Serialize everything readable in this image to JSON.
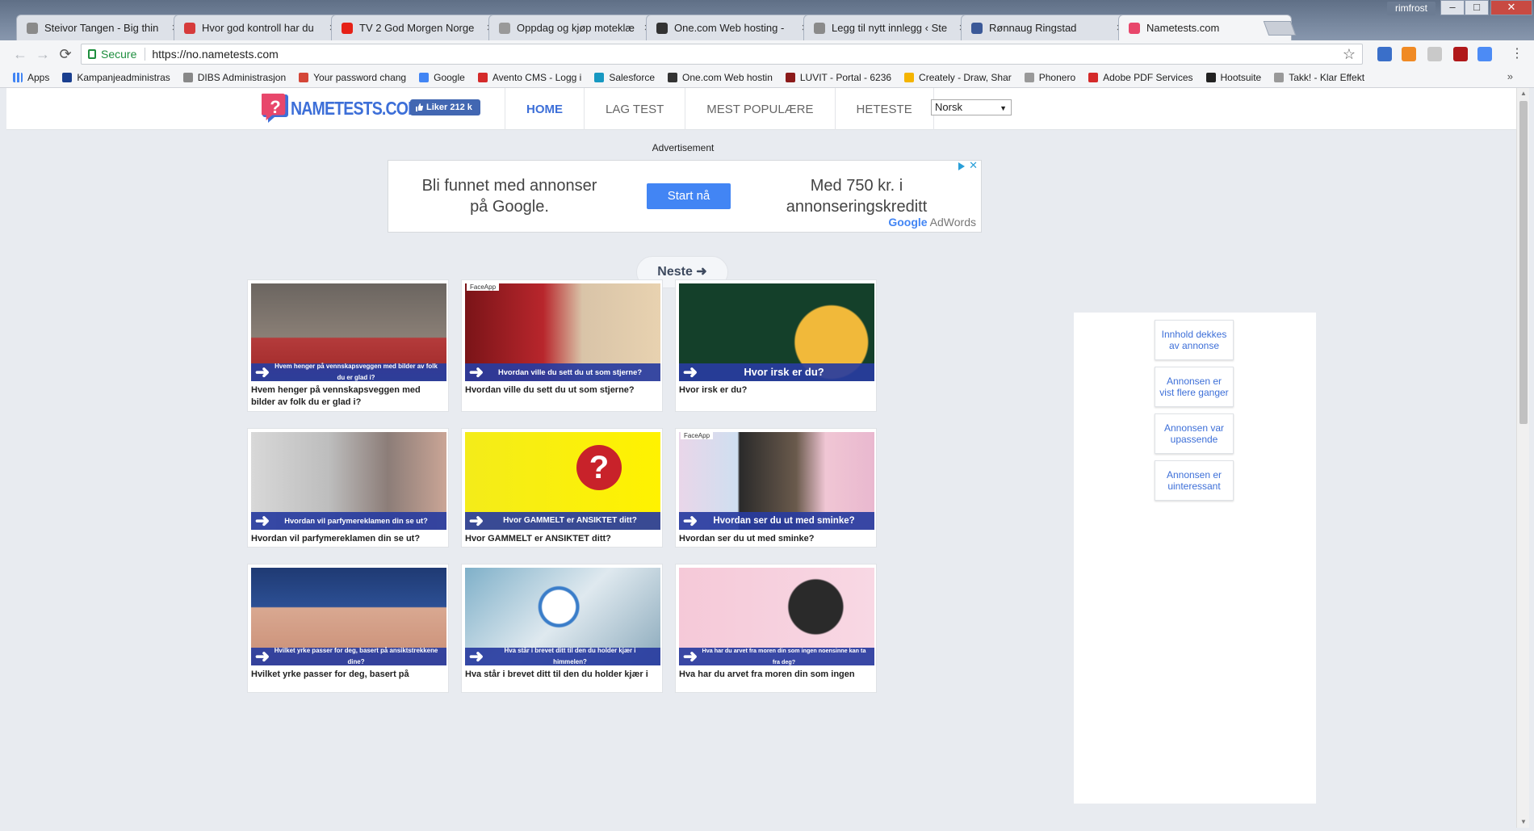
{
  "window": {
    "user": "rimfrost",
    "minimize": "–",
    "maximize": "□",
    "close": "✕"
  },
  "tabs": [
    {
      "title": "Steivor Tangen - Big thin",
      "favicon_color": "#8a8a8a"
    },
    {
      "title": "Hvor god kontroll har du",
      "favicon_color": "#d63b3b"
    },
    {
      "title": "TV 2 God Morgen Norge",
      "favicon_color": "#e62117"
    },
    {
      "title": "Oppdag og kjøp moteklæ",
      "favicon_color": "#999999"
    },
    {
      "title": "One.com Web hosting -",
      "favicon_color": "#333333"
    },
    {
      "title": "Legg til nytt innlegg ‹ Ste",
      "favicon_color": "#8a8a8a"
    },
    {
      "title": "Rønnaug Ringstad",
      "favicon_color": "#3b5998"
    },
    {
      "title": "Nametests.com",
      "favicon_color": "#e8476b"
    }
  ],
  "toolbar": {
    "back": "←",
    "forward": "→",
    "reload": "⟳",
    "secure_label": "Secure",
    "url_scheme": "https://",
    "url_host": "no.nametests.com",
    "star": "☆",
    "menu": "⋮"
  },
  "bookmarks": [
    {
      "label": "Apps",
      "color": "#4285f4"
    },
    {
      "label": "Kampanjeadministras",
      "color": "#1a3f8f"
    },
    {
      "label": "DIBS Administrasjon",
      "color": "#888888"
    },
    {
      "label": "Your password chang",
      "color": "#d44638"
    },
    {
      "label": "Google",
      "color": "#4285f4"
    },
    {
      "label": "Avento CMS - Logg i",
      "color": "#d42a2a"
    },
    {
      "label": "Salesforce",
      "color": "#1798c1"
    },
    {
      "label": "One.com Web hostin",
      "color": "#333333"
    },
    {
      "label": "LUVIT - Portal - 6236",
      "color": "#8b1a1a"
    },
    {
      "label": "Creately - Draw, Shar",
      "color": "#f4b400"
    },
    {
      "label": "Phonero",
      "color": "#999999"
    },
    {
      "label": "Adobe PDF Services",
      "color": "#d42a2a"
    },
    {
      "label": "Hootsuite",
      "color": "#222222"
    },
    {
      "label": "Takk! - Klar Effekt",
      "color": "#999999"
    }
  ],
  "bookmarks_overflow": "»",
  "site": {
    "logo_text": "NAMETESTS.COM",
    "like_label": "Liker 212 k",
    "nav": [
      "HOME",
      "LAG TEST",
      "MEST POPULÆRE",
      "HETESTE"
    ],
    "active_nav": 0,
    "language": "Norsk",
    "brand_color": "#3d6fd8"
  },
  "ad": {
    "label": "Advertisement",
    "left_text": "Bli funnet med annonser på Google.",
    "cta": "Start nå",
    "right_text": "Med 750 kr. i annonseringskreditt",
    "brand_google": "Google",
    "brand_adwords": " AdWords",
    "close": "✕"
  },
  "next_button": "Neste ➜",
  "sidebar_buttons": [
    "Innhold dekkes av annonse",
    "Annonsen er vist flere ganger",
    "Annonsen var upassende",
    "Annonsen er uinteressant"
  ],
  "cards": [
    {
      "banner": "Hvem henger på vennskapsveggen med bilder av folk du er glad i?",
      "title": "Hvem henger på vennskapsveggen med bilder av folk du er glad i?",
      "banner_size": 11,
      "faceapp": false
    },
    {
      "banner": "Hvordan ville du sett du ut som stjerne?",
      "title": "Hvordan ville du sett du ut som stjerne?",
      "banner_size": 13,
      "faceapp": true
    },
    {
      "banner": "Hvor irsk er du?",
      "title": "Hvor irsk er du?",
      "banner_size": 22,
      "faceapp": false
    },
    {
      "banner": "Hvordan vil parfymereklamen din se ut?",
      "title": "Hvordan vil parfymereklamen din se ut?",
      "banner_size": 13,
      "faceapp": false
    },
    {
      "banner": "Hvor GAMMELT er ANSIKTET ditt?",
      "title": "Hvor GAMMELT er ANSIKTET ditt?",
      "banner_size": 14,
      "faceapp": false
    },
    {
      "banner": "Hvordan ser du ut med sminke?",
      "title": "Hvordan ser du ut med sminke?",
      "banner_size": 16,
      "faceapp": true
    },
    {
      "banner": "Hvilket yrke passer for deg, basert på ansiktstrekkene dine?",
      "title": "Hvilket yrke passer for deg, basert på",
      "banner_size": 11,
      "faceapp": false
    },
    {
      "banner": "Hva står i brevet ditt til den du holder kjær i himmelen?",
      "title": "Hva står i brevet ditt til den du holder kjær i",
      "banner_size": 11,
      "faceapp": false
    },
    {
      "banner": "Hva har du arvet fra moren din som ingen noensinne kan ta fra deg?",
      "title": "Hva har du arvet fra moren din som ingen",
      "banner_size": 10,
      "faceapp": false
    }
  ],
  "faceapp_tag": "FaceApp"
}
